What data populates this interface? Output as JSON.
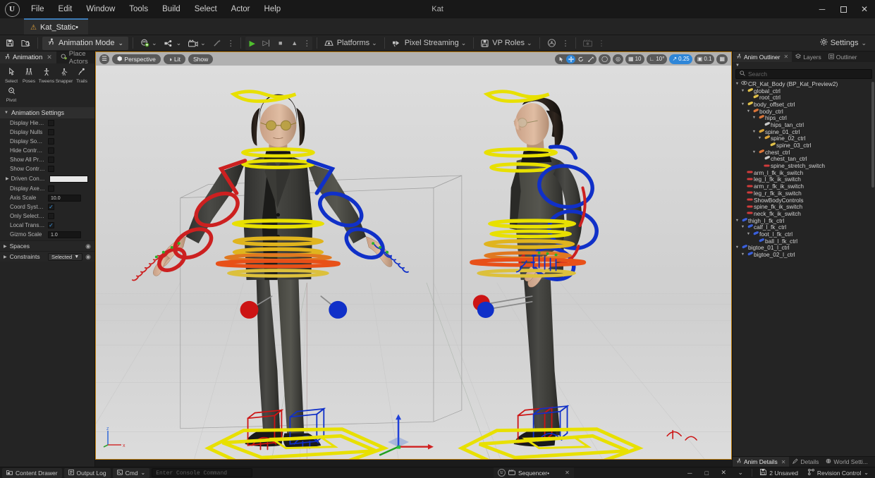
{
  "window": {
    "app_title": "Kat",
    "minimize": "─",
    "maximize": "❐",
    "close": "✕"
  },
  "menu": {
    "items": [
      {
        "label": "File"
      },
      {
        "label": "Edit"
      },
      {
        "label": "Window"
      },
      {
        "label": "Tools"
      },
      {
        "label": "Build"
      },
      {
        "label": "Select"
      },
      {
        "label": "Actor"
      },
      {
        "label": "Help"
      }
    ]
  },
  "project_tab": {
    "label": "Kat_Static•",
    "icon": "warning-icon"
  },
  "toolbar": {
    "save_icon": "save-icon",
    "browse_icon": "browse-content-icon",
    "mode_label": "Animation Mode",
    "mode_caret": "⌄",
    "create_label": "",
    "quick_add_caret": "⌄",
    "blueprint_caret": "⌄",
    "cinematics_caret": "⌄",
    "wand_icon": "magic-wand-icon",
    "more_dots": "⋮",
    "play_icon": "▶",
    "skip_icon": "⏵",
    "stop_icon": "■",
    "eject_icon": "⏏",
    "platforms_label": "Platforms",
    "pixel_streaming_label": "Pixel Streaming",
    "vp_roles_label": "VP Roles",
    "settings_label": "Settings",
    "settings_caret": "⌄"
  },
  "left_panel": {
    "tabs": [
      {
        "label": "Animation",
        "icon": "run-figure-icon",
        "active": true,
        "closable": true
      },
      {
        "label": "Place Actors",
        "icon": "place-actors-icon",
        "active": false,
        "closable": false
      }
    ],
    "tools": [
      {
        "label": "Select",
        "glyph": "☝",
        "name": "select-tool"
      },
      {
        "label": "Poses",
        "glyph": "♟",
        "name": "poses-tool"
      },
      {
        "label": "Tweens",
        "glyph": "⚔",
        "name": "tweens-tool"
      },
      {
        "label": "Snapper",
        "glyph": "⚒",
        "name": "snapper-tool"
      },
      {
        "label": "Trails",
        "glyph": "⚘",
        "name": "trails-tool"
      },
      {
        "label": "Pivot",
        "glyph": "◉",
        "name": "pivot-tool"
      }
    ],
    "section_title": "Animation Settings",
    "properties": [
      {
        "label": "Display Hierar...",
        "type": "checkbox",
        "value": false
      },
      {
        "label": "Display Nulls",
        "type": "checkbox",
        "value": false
      },
      {
        "label": "Display Sockets",
        "type": "checkbox",
        "value": false
      },
      {
        "label": "Hide Control S...",
        "type": "checkbox",
        "value": false
      },
      {
        "label": "Show All Proxy ...",
        "type": "checkbox",
        "value": false
      },
      {
        "label": "Show Controls...",
        "type": "checkbox",
        "value": false
      },
      {
        "label": "Driven Control...",
        "type": "white-field",
        "value": ""
      },
      {
        "label": "Display Axes o...",
        "type": "checkbox",
        "value": false
      },
      {
        "label": "Axis Scale",
        "type": "number",
        "value": "10.0"
      },
      {
        "label": "Coord System...",
        "type": "checkbox",
        "value": true
      },
      {
        "label": "Only Select Rig...",
        "type": "checkbox",
        "value": false
      },
      {
        "label": "Local Transfor...",
        "type": "checkbox",
        "value": true
      },
      {
        "label": "Gizmo Scale",
        "type": "number",
        "value": "1.0"
      }
    ],
    "sub_sections": [
      {
        "label": "Spaces",
        "control": null
      },
      {
        "label": "Constraints",
        "control": "Selected"
      }
    ]
  },
  "viewport": {
    "left_controls": [
      {
        "name": "viewport-options-icon",
        "glyph": "☰",
        "round": true
      },
      {
        "name": "perspective-button",
        "label": "Perspective",
        "glyph": "⬢"
      },
      {
        "name": "lit-button",
        "label": "Lit",
        "glyph": "◑"
      },
      {
        "name": "show-button",
        "label": "Show",
        "glyph": ""
      }
    ],
    "transform_tools": [
      {
        "name": "select-mode",
        "glyph": "➤",
        "selected": false
      },
      {
        "name": "translate-mode",
        "glyph": "✚",
        "selected": true
      },
      {
        "name": "rotate-mode",
        "glyph": "↻",
        "selected": false
      },
      {
        "name": "scale-mode",
        "glyph": "⤧",
        "selected": false
      }
    ],
    "coord_space_icon": "⊖",
    "world_space_icon": "⊕",
    "grid_snap_value": "10",
    "rotation_snap_value": "10°",
    "scale_snap_value": "0.25",
    "camera_speed_value": "0.1",
    "layout_icon": "⊞",
    "axis_labels": {
      "z": "z",
      "x": "x",
      "y": "y"
    }
  },
  "right_panel": {
    "tabs": [
      {
        "label": "Anim Outliner",
        "icon": "anim-outliner-icon",
        "active": true,
        "closable": true
      },
      {
        "label": "Layers",
        "icon": "layers-icon",
        "active": false,
        "closable": false
      },
      {
        "label": "Outliner",
        "icon": "outliner-icon",
        "active": false,
        "closable": false
      }
    ],
    "search_placeholder": "Search",
    "tree": [
      {
        "depth": 0,
        "label": "CR_Kat_Body  (BP_Kat_Preview2)",
        "arrow": "▼",
        "glyph": "eye-icon",
        "color": "#d6d6d6",
        "type": "root"
      },
      {
        "depth": 1,
        "label": "global_ctrl",
        "arrow": "▼",
        "glyph": "ctrl-icon",
        "color": "#e0c04a",
        "type": "ctrl"
      },
      {
        "depth": 2,
        "label": "root_ctrl",
        "arrow": "",
        "glyph": "ctrl-icon",
        "color": "#e0c04a",
        "type": "ctrl"
      },
      {
        "depth": 1,
        "label": "body_offset_ctrl",
        "arrow": "▼",
        "glyph": "ctrl-icon",
        "color": "#e0c04a",
        "type": "ctrl"
      },
      {
        "depth": 2,
        "label": "body_ctrl",
        "arrow": "▼",
        "glyph": "ctrl-icon",
        "color": "#d8743a",
        "type": "ctrl"
      },
      {
        "depth": 3,
        "label": "hips_ctrl",
        "arrow": "▼",
        "glyph": "ctrl-icon",
        "color": "#d8743a",
        "type": "ctrl"
      },
      {
        "depth": 4,
        "label": "hips_tan_ctrl",
        "arrow": "",
        "glyph": "ctrl-icon",
        "color": "#c8c8c8",
        "type": "ctrl"
      },
      {
        "depth": 3,
        "label": "spine_01_ctrl",
        "arrow": "▼",
        "glyph": "ctrl-icon",
        "color": "#d8a33a",
        "type": "ctrl"
      },
      {
        "depth": 4,
        "label": "spine_02_ctrl",
        "arrow": "▼",
        "glyph": "ctrl-icon",
        "color": "#d8a33a",
        "type": "ctrl"
      },
      {
        "depth": 5,
        "label": "spine_03_ctrl",
        "arrow": "",
        "glyph": "ctrl-icon",
        "color": "#e0c04a",
        "type": "ctrl"
      },
      {
        "depth": 3,
        "label": "chest_ctrl",
        "arrow": "▼",
        "glyph": "ctrl-icon",
        "color": "#d8743a",
        "type": "ctrl"
      },
      {
        "depth": 4,
        "label": "chest_tan_ctrl",
        "arrow": "",
        "glyph": "ctrl-icon",
        "color": "#c8c8c8",
        "type": "ctrl"
      },
      {
        "depth": 4,
        "label": "spine_stretch_switch",
        "arrow": "",
        "glyph": "switch-icon",
        "color": "#d13b3b",
        "type": "switch"
      },
      {
        "depth": 1,
        "label": "arm_l_fk_ik_switch",
        "arrow": "",
        "glyph": "switch-icon",
        "color": "#d13b3b",
        "type": "switch"
      },
      {
        "depth": 1,
        "label": "leg_l_fk_ik_switch",
        "arrow": "",
        "glyph": "switch-icon",
        "color": "#d13b3b",
        "type": "switch"
      },
      {
        "depth": 1,
        "label": "arm_r_fk_ik_switch",
        "arrow": "",
        "glyph": "switch-icon",
        "color": "#d13b3b",
        "type": "switch"
      },
      {
        "depth": 1,
        "label": "leg_r_fk_ik_switch",
        "arrow": "",
        "glyph": "switch-icon",
        "color": "#d13b3b",
        "type": "switch"
      },
      {
        "depth": 1,
        "label": "ShowBodyControls",
        "arrow": "",
        "glyph": "switch-icon",
        "color": "#d13b3b",
        "type": "switch"
      },
      {
        "depth": 1,
        "label": "spine_fk_ik_switch",
        "arrow": "",
        "glyph": "switch-icon",
        "color": "#d13b3b",
        "type": "switch"
      },
      {
        "depth": 1,
        "label": "neck_fk_ik_switch",
        "arrow": "",
        "glyph": "switch-icon",
        "color": "#d13b3b",
        "type": "switch"
      },
      {
        "depth": 0,
        "label": "thigh_l_fk_ctrl",
        "arrow": "▼",
        "glyph": "ctrl-icon",
        "color": "#3a5fd8",
        "type": "ctrl"
      },
      {
        "depth": 1,
        "label": "calf_l_fk_ctrl",
        "arrow": "▼",
        "glyph": "ctrl-icon",
        "color": "#3a5fd8",
        "type": "ctrl"
      },
      {
        "depth": 2,
        "label": "foot_l_fk_ctrl",
        "arrow": "▼",
        "glyph": "ctrl-icon",
        "color": "#3a5fd8",
        "type": "ctrl"
      },
      {
        "depth": 3,
        "label": "ball_l_fk_ctrl",
        "arrow": "",
        "glyph": "ctrl-icon",
        "color": "#3a5fd8",
        "type": "ctrl"
      },
      {
        "depth": 0,
        "label": "bigtoe_01_l_ctrl",
        "arrow": "▼",
        "glyph": "ctrl-icon",
        "color": "#3a5fd8",
        "type": "ctrl"
      },
      {
        "depth": 1,
        "label": "bigtoe_02_l_ctrl",
        "arrow": "▼",
        "glyph": "ctrl-icon",
        "color": "#3a5fd8",
        "type": "ctrl"
      }
    ],
    "bottom_tabs": [
      {
        "label": "Anim Details",
        "icon": "anim-details-icon",
        "active": true,
        "closable": true
      },
      {
        "label": "Details",
        "icon": "details-pencil-icon",
        "active": false,
        "closable": false
      },
      {
        "label": "World Setti...",
        "icon": "world-settings-icon",
        "active": false,
        "closable": false
      }
    ]
  },
  "statusbar": {
    "content_drawer": "Content Drawer",
    "output_log": "Output Log",
    "cmd_label": "Cmd",
    "cmd_caret": "⌄",
    "console_placeholder": "Enter Console Command",
    "sequencer_tab": "Sequencer•",
    "sequencer_close": "✕",
    "unsaved_label": "2 Unsaved",
    "revision_control": "Revision Control",
    "revision_caret": "⌄",
    "win_minimize": "─",
    "win_restore": "□",
    "win_close": "✕",
    "win_caret": "⌄"
  },
  "colors": {
    "accent_blue": "#2e86d8",
    "rig_yellow": "#e8e000",
    "rig_red": "#cc2020",
    "rig_blue": "#1030c8",
    "rig_orange": "#e08020",
    "tab_accent": "#3d7ab5"
  }
}
